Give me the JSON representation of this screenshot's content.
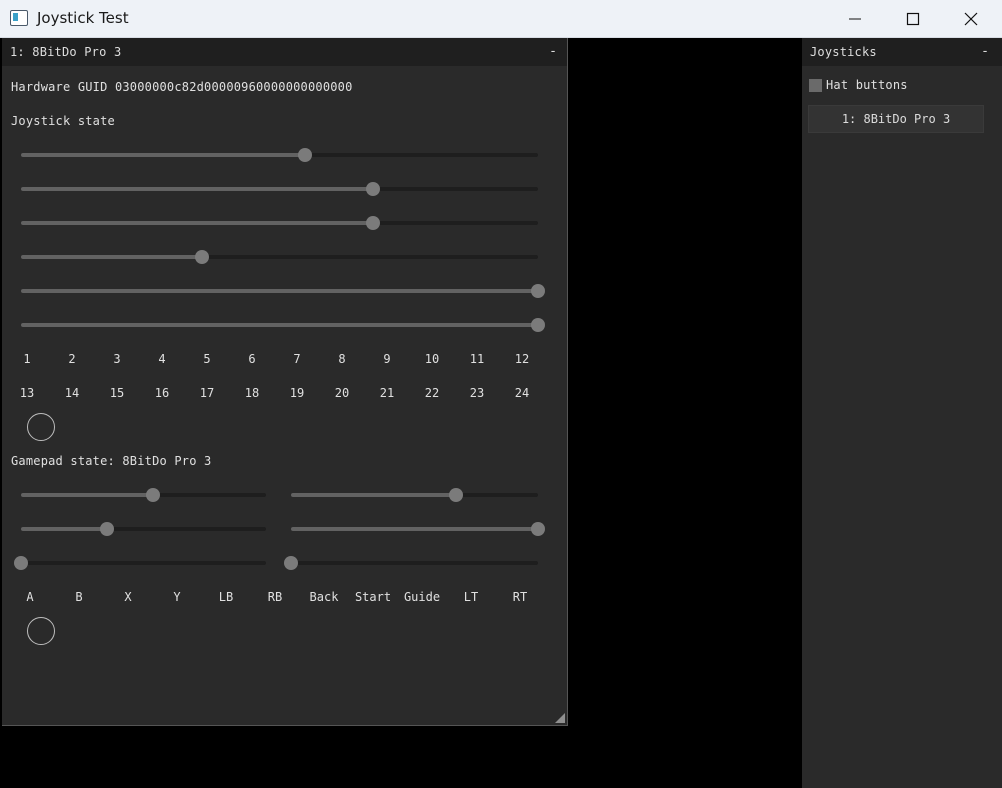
{
  "window": {
    "title": "Joystick Test",
    "controls": {
      "minimize": "minimize-icon",
      "maximize": "maximize-icon",
      "close": "close-icon"
    }
  },
  "joystick_panel": {
    "title": "1: 8BitDo Pro 3",
    "collapse": "-",
    "guid_text": "Hardware GUID 03000000c82d00000960000000000000",
    "state_heading": "Joystick state",
    "axes": [
      0.55,
      0.68,
      0.68,
      0.35,
      1.0,
      1.0
    ],
    "buttons_row1": [
      "1",
      "2",
      "3",
      "4",
      "5",
      "6",
      "7",
      "8",
      "9",
      "10",
      "11",
      "12"
    ],
    "buttons_row2": [
      "13",
      "14",
      "15",
      "16",
      "17",
      "18",
      "19",
      "20",
      "21",
      "22",
      "23",
      "24"
    ],
    "gamepad_heading": "Gamepad state: 8BitDo Pro 3",
    "gamepad_axes_left": [
      0.54,
      0.35,
      0.0
    ],
    "gamepad_axes_right": [
      0.67,
      1.0,
      0.0
    ],
    "gamepad_buttons": [
      "A",
      "B",
      "X",
      "Y",
      "LB",
      "RB",
      "Back",
      "Start",
      "Guide",
      "LT",
      "RT"
    ]
  },
  "joysticks_panel": {
    "title": "Joysticks",
    "collapse": "-",
    "hat_checkbox_label": "Hat buttons",
    "hat_checked": false,
    "devices": [
      "1: 8BitDo Pro 3"
    ]
  },
  "colors": {
    "panel_bg": "#2a2a2a",
    "header_bg": "#1f1f1f",
    "slider_thumb": "#7b7b7b",
    "background": "#000000"
  }
}
